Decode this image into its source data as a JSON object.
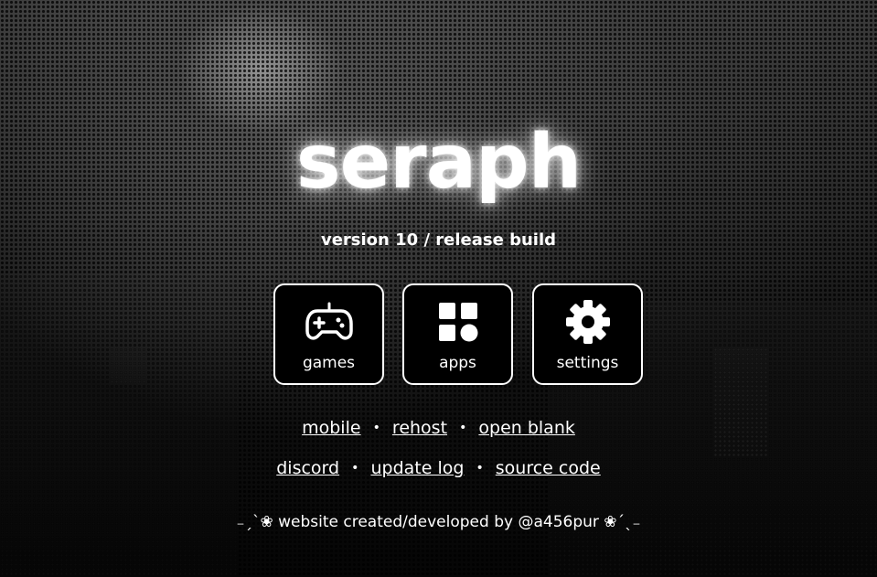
{
  "hero": {
    "title": "seraph",
    "version": "version 10 / release build"
  },
  "tiles": [
    {
      "label": "games",
      "icon": "gamepad-icon"
    },
    {
      "label": "apps",
      "icon": "apps-grid-icon"
    },
    {
      "label": "settings",
      "icon": "gear-icon"
    }
  ],
  "links_row1": [
    {
      "label": "mobile"
    },
    {
      "label": "rehost"
    },
    {
      "label": "open blank"
    }
  ],
  "links_row2": [
    {
      "label": "discord"
    },
    {
      "label": "update log"
    },
    {
      "label": "source code"
    }
  ],
  "separator": "•",
  "footer": {
    "text": "₋ˏˋ❀ website created/developed by @a456pur ❀ˊˎ₋"
  },
  "colors": {
    "text": "#ffffff",
    "tile_bg": "#000000",
    "tile_border": "#ffffff"
  }
}
